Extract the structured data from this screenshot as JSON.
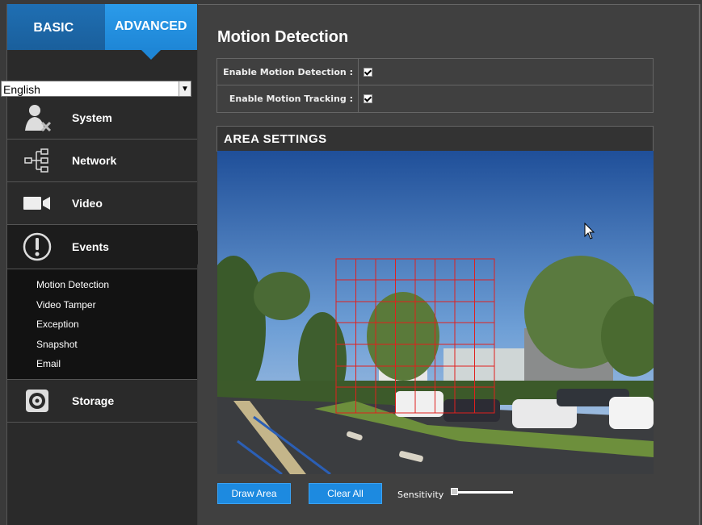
{
  "tabs": {
    "basic": "BASIC",
    "advanced": "ADVANCED"
  },
  "language": {
    "selected": "English"
  },
  "nav": {
    "system": "System",
    "network": "Network",
    "video": "Video",
    "events": "Events",
    "storage": "Storage"
  },
  "events_sub": [
    "Motion Detection",
    "Video Tamper",
    "Exception",
    "Snapshot",
    "Email"
  ],
  "page": {
    "title": "Motion Detection"
  },
  "form": {
    "enable_detection_label": "Enable Motion Detection :",
    "enable_detection_checked": true,
    "enable_tracking_label": "Enable Motion Tracking :",
    "enable_tracking_checked": true
  },
  "area": {
    "header": "AREA SETTINGS"
  },
  "buttons": {
    "draw": "Draw Area",
    "clear": "Clear All"
  },
  "sensitivity": {
    "label": "Sensitivity",
    "value_fraction": 0.05
  },
  "colors": {
    "accent": "#1d8ae0",
    "grid": "#e0201e"
  }
}
